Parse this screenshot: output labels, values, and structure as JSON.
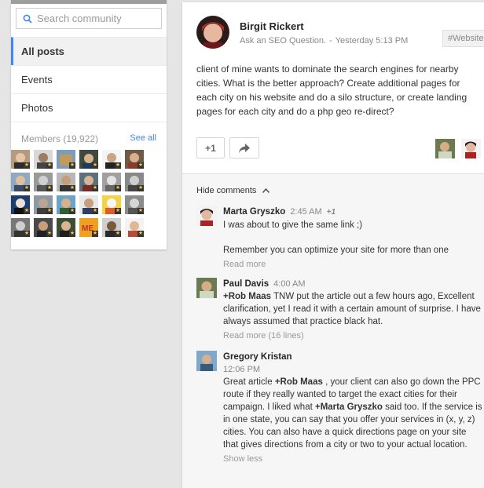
{
  "search": {
    "placeholder": "Search community"
  },
  "nav": {
    "items": [
      "All posts",
      "Events",
      "Photos"
    ]
  },
  "members": {
    "label": "Members (19,922)",
    "see_all": "See all"
  },
  "post": {
    "author": "Birgit Rickert",
    "category": "Ask an SEO Question.",
    "separator": "-",
    "time": "Yesterday 5:13 PM",
    "tag": "#Website",
    "body": "client of mine wants to dominate the search engines for nearby cities. What is the better approach?  Create additional pages for each city on his website and do a silo structure, or create landing pages for each city and do a php geo re-direct?",
    "plus_one": "+1"
  },
  "comments_toggle": "Hide comments",
  "comments": [
    {
      "name": "Marta Gryszko",
      "time": "2:45 AM",
      "plus": "+1",
      "line1": "I was about to give the same link ;)",
      "line2": "Remember you can optimize your site for more than one",
      "more": "Read more"
    },
    {
      "name": "Paul Davis",
      "time": "4:00 AM",
      "mention": "+Rob Maas",
      "text": " TNW put the article out a few hours ago, Excellent clarification, yet I read it with a certain amount of surprise. I have always assumed that practice black hat.",
      "more": "Read more (16 lines)"
    },
    {
      "name": "Gregory Kristan",
      "time": "12:06 PM",
      "pre": "Great article ",
      "mention": "+Rob Maas",
      "mid": " , your client can also go down the PPC route if they really wanted to target the exact cities for their campaign. I liked what ",
      "mention2": "+Marta Gryszko",
      "post": " said too. If the service is in one state, you can say that you offer your services in (x, y, z) cities. You can also have a quick directions page on your site that gives directions from a city or two to your actual location.",
      "more": "Show less"
    }
  ],
  "colors": {
    "accent": "#4285f4",
    "badge": "#f6c343"
  }
}
